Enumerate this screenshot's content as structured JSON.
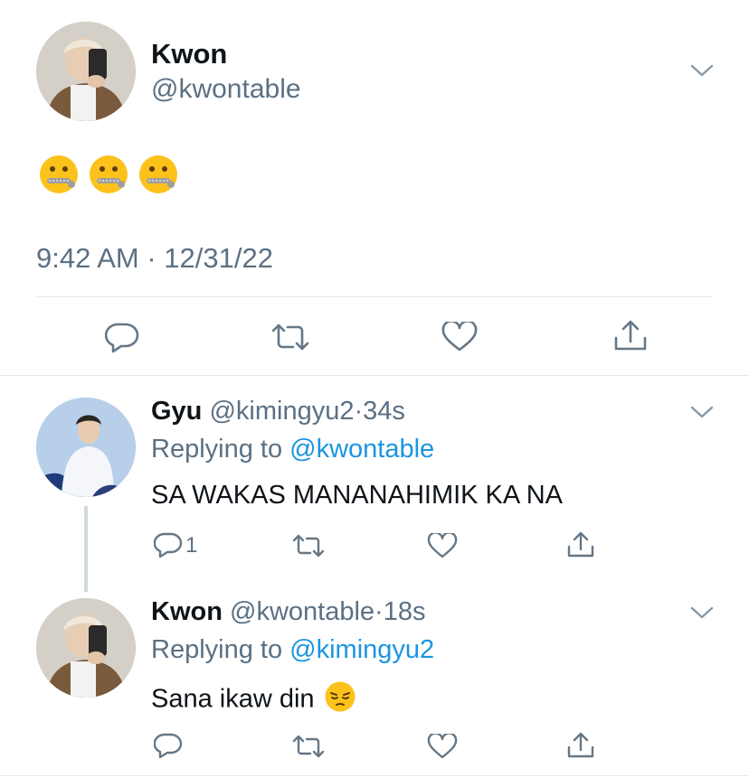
{
  "main_tweet": {
    "author_name": "Kwon",
    "author_handle": "@kwontable",
    "timestamp": "9:42 AM · 12/31/22",
    "content_emoji_icons": [
      "zipper-mouth-face-icon",
      "zipper-mouth-face-icon",
      "zipper-mouth-face-icon"
    ]
  },
  "replies": [
    {
      "author_name": "Gyu",
      "author_handle": "@kimingyu2",
      "separator": "·",
      "age": "34s",
      "replying_prefix": "Replying to",
      "replying_to": "@kwontable",
      "text": "SA WAKAS MANANAHIMIK KA NA",
      "reply_count": "1"
    },
    {
      "author_name": "Kwon",
      "author_handle": "@kwontable",
      "separator": "·",
      "age": "18s",
      "replying_prefix": "Replying to",
      "replying_to": "@kimingyu2",
      "text": "Sana ikaw din",
      "trailing_emoji_icon": "pensive-face-icon",
      "reply_count": ""
    }
  ],
  "colors": {
    "accent": "#1b95e0",
    "secondary_text": "#5b7083",
    "icon_grey": "#657786",
    "divider": "#e1e8ed"
  }
}
